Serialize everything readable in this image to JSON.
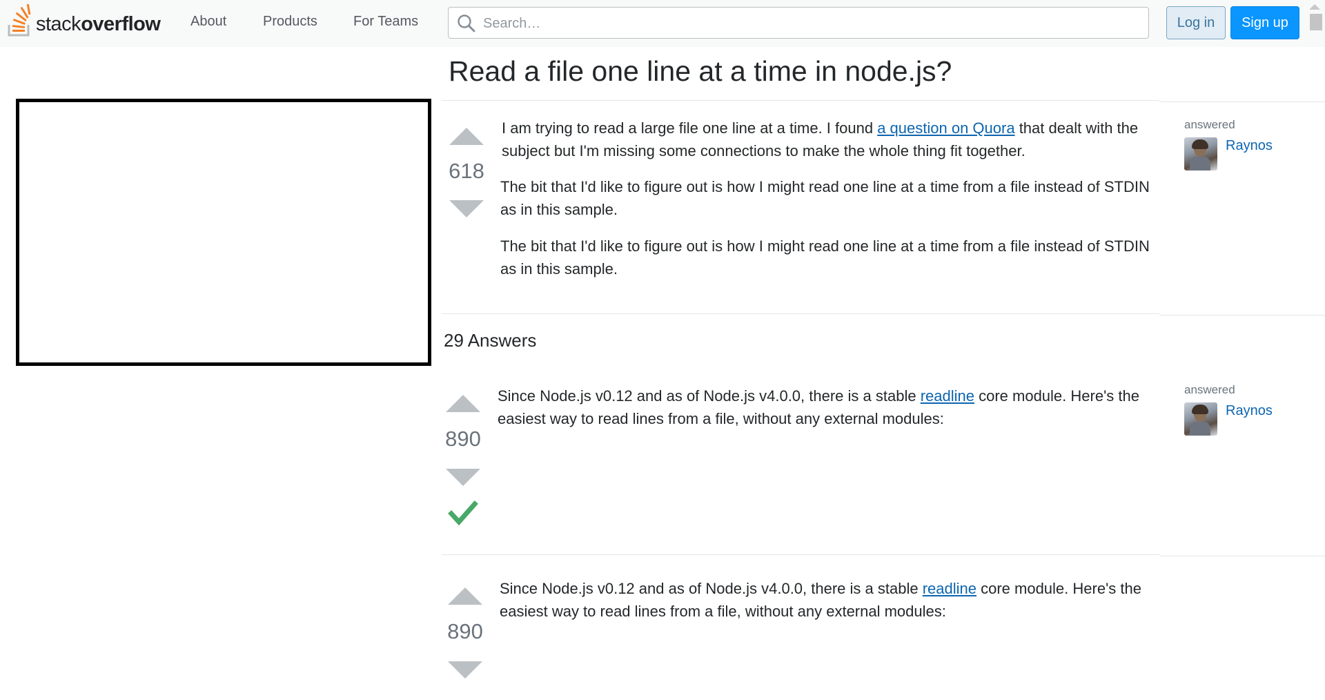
{
  "header": {
    "logo_prefix": "stack",
    "logo_bold": "overflow",
    "nav": [
      "About",
      "Products",
      "For Teams"
    ],
    "search_placeholder": "Search…",
    "login_label": "Log in",
    "signup_label": "Sign up"
  },
  "question": {
    "title": "Read a file one line at a time in node.js?",
    "votes": "618",
    "para1_before": "I am trying to read a large file one line at a time. I found ",
    "para1_link": "a question on Quora",
    "para1_after": " that dealt with the",
    "para1_line2": "subject but I'm missing some connections to make the whole thing fit together.",
    "para2_line1": "The bit that I'd like to figure out is how I might read one line at a time from a file instead of STDIN",
    "para2_line2": "as in this sample.",
    "para3_line1": "The bit that I'd like to figure out is how I might read one line at a time from a file instead of STDIN",
    "para3_line2": "as in this sample.",
    "answered_label": "answered",
    "user": "Raynos"
  },
  "answers_header": "29 Answers",
  "answers": [
    {
      "votes": "890",
      "accepted": true,
      "text_before": "Since Node.js v0.12 and as of Node.js v4.0.0, there is a stable ",
      "link": "readline",
      "text_after": " core module. Here's the",
      "line2": "easiest way to read lines from a file, without any external modules:",
      "answered_label": "answered",
      "user": "Raynos"
    },
    {
      "votes": "890",
      "accepted": false,
      "text_before": "Since Node.js v0.12 and as of Node.js v4.0.0, there is a stable ",
      "link": "readline",
      "text_after": " core module. Here's the",
      "line2": "easiest way to read lines from a file, without any external modules:"
    }
  ],
  "colors": {
    "accent_blue": "#0a95ff",
    "link_blue": "#0c65b0",
    "accepted_green": "#48a868",
    "logo_orange": "#f48024"
  }
}
